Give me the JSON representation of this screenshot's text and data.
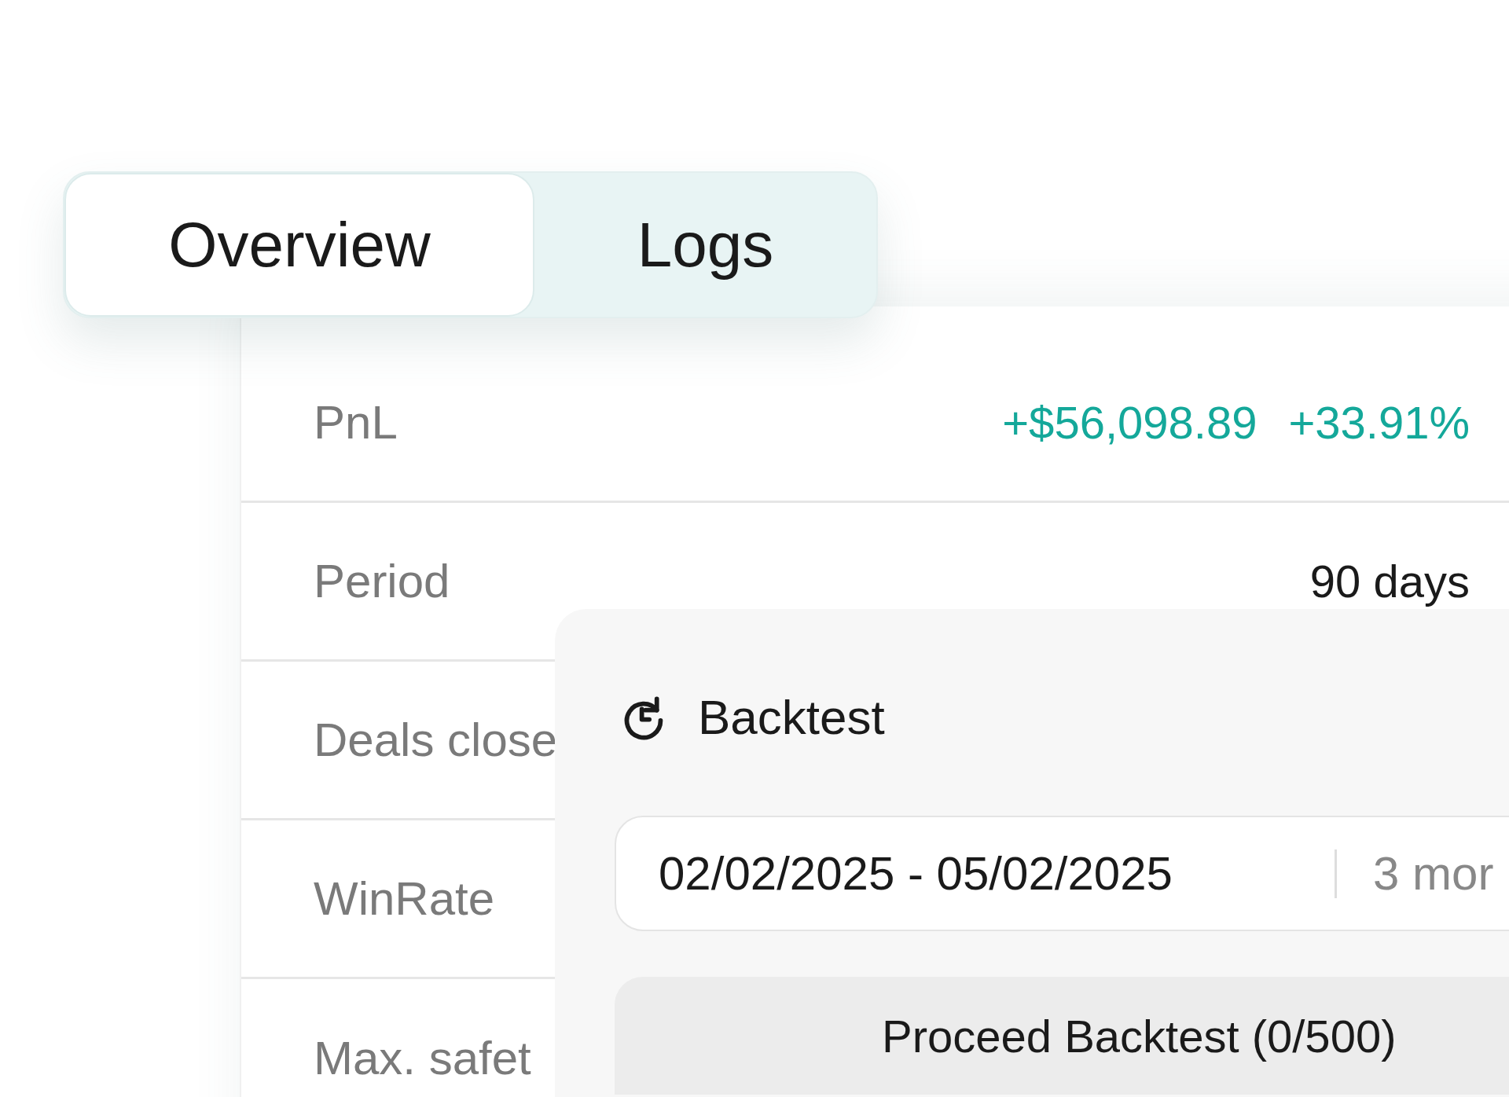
{
  "tabs": [
    {
      "label": "Overview",
      "selected": true
    },
    {
      "label": "Logs",
      "selected": false
    }
  ],
  "stats": [
    {
      "label": "PnL",
      "values": [
        {
          "text": "+$56,098.89",
          "color": "#14a89a"
        },
        {
          "text": "+33.91%",
          "color": "#14a89a"
        }
      ]
    },
    {
      "label": "Period",
      "values": [
        {
          "text": "90 days",
          "color": "#1a1a1a"
        }
      ]
    },
    {
      "label": "Deals close"
    },
    {
      "label": "WinRate"
    },
    {
      "label": "Max. safet"
    }
  ],
  "backtest": {
    "title": "Backtest",
    "date_range": "02/02/2025 - 05/02/2025",
    "duration": "3 mor",
    "button": "Proceed Backtest (0/500)"
  }
}
